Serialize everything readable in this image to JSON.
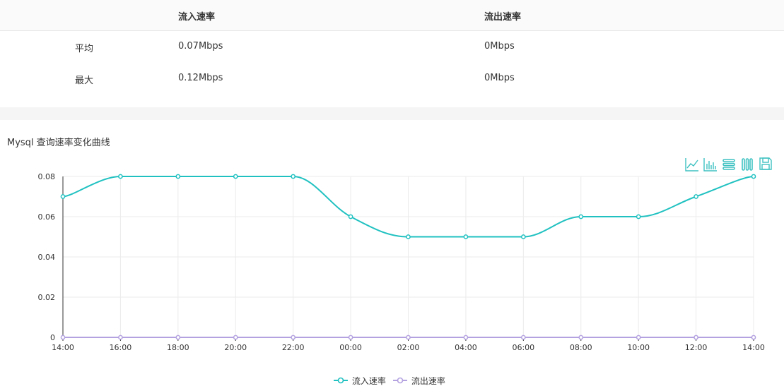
{
  "stats": {
    "headers": [
      "",
      "流入速率",
      "流出速率"
    ],
    "rows": [
      {
        "label": "平均",
        "in": "0.07Mbps",
        "out": "0Mbps"
      },
      {
        "label": "最大",
        "in": "0.12Mbps",
        "out": "0Mbps"
      }
    ]
  },
  "chart_title": "Mysql 查询速率变化曲线",
  "toolbox": {
    "icons": [
      "line-chart-icon",
      "bar-chart-icon",
      "stack-icon",
      "tiled-icon",
      "save-image-icon"
    ],
    "color": "#3fc1c1"
  },
  "chart_data": {
    "type": "line",
    "categories": [
      "14:00",
      "16:00",
      "18:00",
      "20:00",
      "22:00",
      "00:00",
      "02:00",
      "04:00",
      "06:00",
      "08:00",
      "10:00",
      "12:00",
      "14:00"
    ],
    "series": [
      {
        "name": "流入速率",
        "color": "#21c1c1",
        "values": [
          0.07,
          0.08,
          0.08,
          0.08,
          0.08,
          0.06,
          0.05,
          0.05,
          0.05,
          0.06,
          0.06,
          0.07,
          0.08
        ]
      },
      {
        "name": "流出速率",
        "color": "#b3a1e0",
        "values": [
          0,
          0,
          0,
          0,
          0,
          0,
          0,
          0,
          0,
          0,
          0,
          0,
          0
        ]
      }
    ],
    "yticks": [
      "0",
      "0.02",
      "0.04",
      "0.06",
      "0.08"
    ],
    "ylim": [
      0,
      0.08
    ],
    "smooth": true,
    "grid": true,
    "legend": "bottom-center"
  }
}
